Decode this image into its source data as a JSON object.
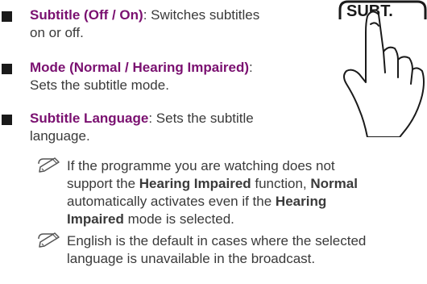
{
  "items": [
    {
      "term": "Subtitle (Off / On)",
      "description_line1": ": Switches subtitles",
      "description_line2": "on or off."
    },
    {
      "term": "Mode (Normal / Hearing Impaired)",
      "description_line1": ":",
      "description_line2": "Sets the subtitle mode."
    },
    {
      "term": "Subtitle Language",
      "description_line1": ": Sets the subtitle",
      "description_line2": "language."
    }
  ],
  "notes": [
    {
      "icon": "note-pencil-icon",
      "parts": {
        "p1": "If the programme you are watching does not",
        "p2": "support the ",
        "b1": "Hearing Impaired",
        "p3": " function, ",
        "b2": "Normal",
        "p4": "automatically activates even if the ",
        "b3": "Hearing",
        "b4": "Impaired",
        "p5": " mode is selected."
      }
    },
    {
      "icon": "note-pencil-icon",
      "parts": {
        "p1": "English is the default in cases where the selected",
        "p2": "language is unavailable in the broadcast."
      }
    }
  ],
  "remote_button": {
    "label": "SUBT.",
    "icon": "hand-pressing-button-icon"
  },
  "colors": {
    "term": "#7a1070",
    "bullet": "#1a1a1a",
    "text": "#3a3a3a"
  }
}
